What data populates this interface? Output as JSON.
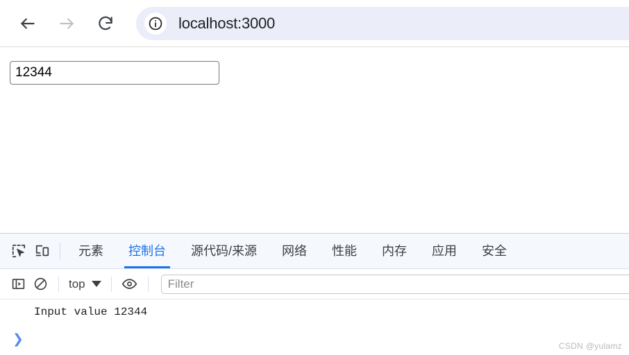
{
  "browser": {
    "back_label": "Back",
    "forward_label": "Forward",
    "reload_label": "Reload",
    "site_info_label": "View site information",
    "url": "localhost:3000"
  },
  "page": {
    "input_value": "12344",
    "input_placeholder": ""
  },
  "devtools": {
    "inspect_label": "Inspect element",
    "device_toolbar_label": "Toggle device toolbar",
    "tabs": [
      {
        "label": "元素",
        "active": false
      },
      {
        "label": "控制台",
        "active": true
      },
      {
        "label": "源代码/来源",
        "active": false
      },
      {
        "label": "网络",
        "active": false
      },
      {
        "label": "性能",
        "active": false
      },
      {
        "label": "内存",
        "active": false
      },
      {
        "label": "应用",
        "active": false
      },
      {
        "label": "安全",
        "active": false
      }
    ],
    "console_toolbar": {
      "sidebar_toggle_label": "Show console sidebar",
      "clear_label": "Clear console",
      "context": "top",
      "eye_label": "Create live expression",
      "filter_placeholder": "Filter"
    },
    "console": {
      "messages": [
        {
          "text": "Input value 12344"
        }
      ],
      "prompt": "❯"
    }
  },
  "watermark": "CSDN @yulamz",
  "colors": {
    "accent": "#1a73e8",
    "omnibox_bg": "#ebedf8",
    "prompt": "#5a8ce8"
  }
}
